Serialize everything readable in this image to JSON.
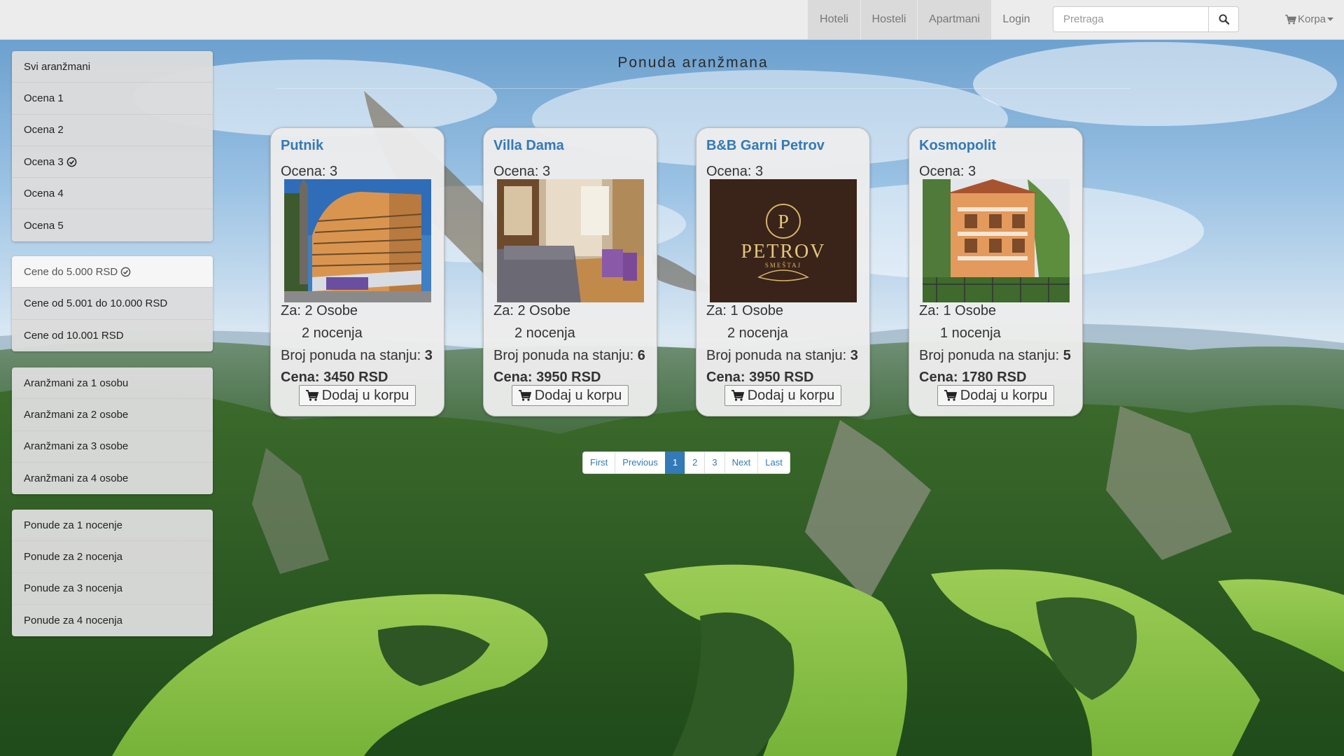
{
  "nav": {
    "links": [
      "Hoteli",
      "Hosteli",
      "Apartmani",
      "Login"
    ],
    "search_placeholder": "Pretraga",
    "cart_label": "Korpa"
  },
  "sidebar": {
    "ratings": [
      "Svi aranžmani",
      "Ocena 1",
      "Ocena 2",
      "Ocena 3",
      "Ocena 4",
      "Ocena 5"
    ],
    "ratings_selected": "Ocena 3",
    "prices": [
      "Cene do 5.000 RSD",
      "Cene od 5.001 do 10.000 RSD",
      "Cene od 10.001 RSD"
    ],
    "prices_selected": "Cene do 5.000 RSD",
    "persons": [
      "Aranžmani za 1 osobu",
      "Aranžmani za 2 osobe",
      "Aranžmani za 3 osobe",
      "Aranžmani za 4 osobe"
    ],
    "nights": [
      "Ponude za 1 nocenje",
      "Ponude za 2 nocenja",
      "Ponude za 3 nocenja",
      "Ponude za 4 nocenja"
    ]
  },
  "main": {
    "title": "Ponuda aranžmana",
    "offers": [
      {
        "name": "Putnik",
        "rating_label": "Ocena: 3",
        "persons": "Za: 2 Osobe",
        "nights": "2 nocenja",
        "stock_label": "Broj ponuda na stanju:",
        "stock": "3",
        "price": "Cena: 3450 RSD",
        "button": "Dodaj u korpu",
        "image": "hotel-building"
      },
      {
        "name": "Villa Dama",
        "rating_label": "Ocena: 3",
        "persons": "Za: 2 Osobe",
        "nights": "2 nocenja",
        "stock_label": "Broj ponuda na stanju:",
        "stock": "6",
        "price": "Cena: 3950 RSD",
        "button": "Dodaj u korpu",
        "image": "apartment-interior"
      },
      {
        "name": "B&B Garni Petrov",
        "rating_label": "Ocena: 3",
        "persons": "Za: 1 Osobe",
        "nights": "2 nocenja",
        "stock_label": "Broj ponuda na stanju:",
        "stock": "3",
        "price": "Cena: 3950 RSD",
        "button": "Dodaj u korpu",
        "image": "petrov-logo",
        "logo_letter": "P",
        "logo_name": "PETROV",
        "logo_sub": "SMEŠTAJ"
      },
      {
        "name": "Kosmopolit",
        "rating_label": "Ocena: 3",
        "persons": "Za: 1 Osobe",
        "nights": "1 nocenja",
        "stock_label": "Broj ponuda na stanju:",
        "stock": "5",
        "price": "Cena: 1780 RSD",
        "button": "Dodaj u korpu",
        "image": "orange-house"
      }
    ]
  },
  "pagination": {
    "items": [
      "First",
      "Previous",
      "1",
      "2",
      "3",
      "Next",
      "Last"
    ],
    "active": "1"
  },
  "colors": {
    "link": "#337ab7",
    "navbar": "#ececec",
    "sidebar": "#dcdcdc",
    "water": "#8cc44a"
  },
  "icons": [
    "search-icon",
    "shopping-cart-icon",
    "caret-down-icon",
    "check-circle-icon"
  ]
}
